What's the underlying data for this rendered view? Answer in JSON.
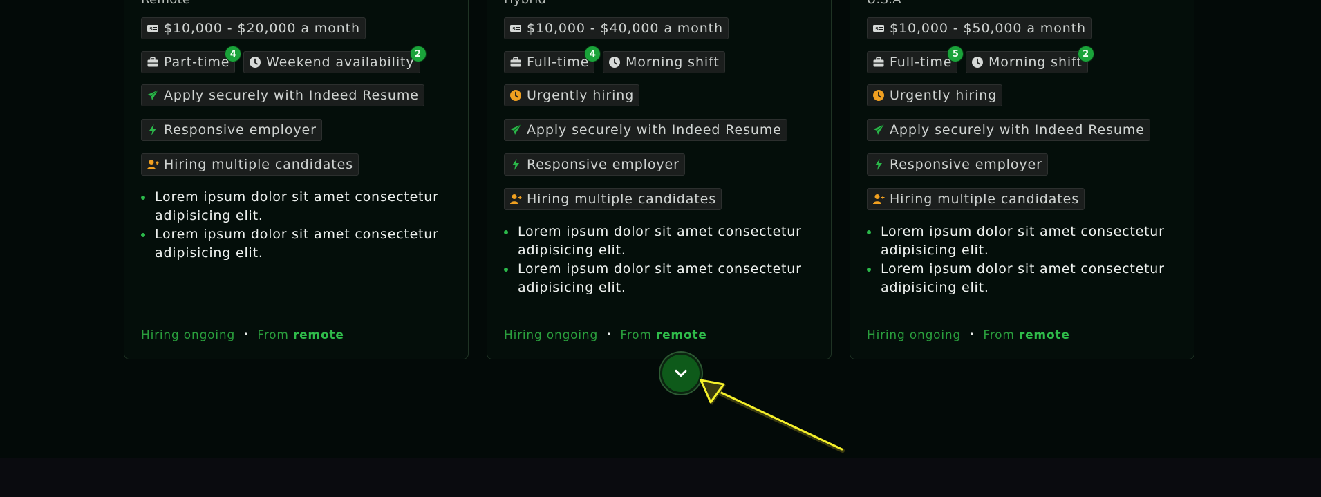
{
  "cards": [
    {
      "location": "Remote",
      "salary": "$10,000 - $20,000 a month",
      "job_type": "Part-time",
      "job_type_badge": "4",
      "schedule": "Weekend availability",
      "schedule_badge": "2",
      "apply": "Apply securely with Indeed Resume",
      "responsive": "Responsive employer",
      "hiring": "Hiring multiple candidates",
      "bullets": [
        "Lorem ipsum dolor sit amet consectetur adipisicing elit.",
        "Lorem ipsum dolor sit amet consectetur adipisicing elit."
      ],
      "footer_status": "Hiring ongoing",
      "footer_dot": "•",
      "footer_from": "From",
      "footer_place": "remote"
    },
    {
      "location": "Hybrid",
      "salary": "$10,000 - $40,000 a month",
      "job_type": "Full-time",
      "job_type_badge": "4",
      "schedule": "Morning shift",
      "urgent": "Urgently hiring",
      "apply": "Apply securely with Indeed Resume",
      "responsive": "Responsive employer",
      "hiring": "Hiring multiple candidates",
      "bullets": [
        "Lorem ipsum dolor sit amet consectetur adipisicing elit.",
        "Lorem ipsum dolor sit amet consectetur adipisicing elit."
      ],
      "footer_status": "Hiring ongoing",
      "footer_dot": "•",
      "footer_from": "From",
      "footer_place": "remote"
    },
    {
      "location": "U.S.A",
      "salary": "$10,000 - $50,000 a month",
      "job_type": "Full-time",
      "job_type_badge": "5",
      "schedule": "Morning shift",
      "schedule_badge": "2",
      "urgent": "Urgently hiring",
      "apply": "Apply securely with Indeed Resume",
      "responsive": "Responsive employer",
      "hiring": "Hiring multiple candidates",
      "bullets": [
        "Lorem ipsum dolor sit amet consectetur adipisicing elit.",
        "Lorem ipsum dolor sit amet consectetur adipisicing elit."
      ],
      "footer_status": "Hiring ongoing",
      "footer_dot": "•",
      "footer_from": "From",
      "footer_place": "remote"
    }
  ],
  "scroll_button": {
    "icon": "chevron-down-icon"
  },
  "colors": {
    "accent_green": "#1aa33a",
    "icon_orange": "#f0a020",
    "annotation_yellow": "#f5f02a"
  }
}
